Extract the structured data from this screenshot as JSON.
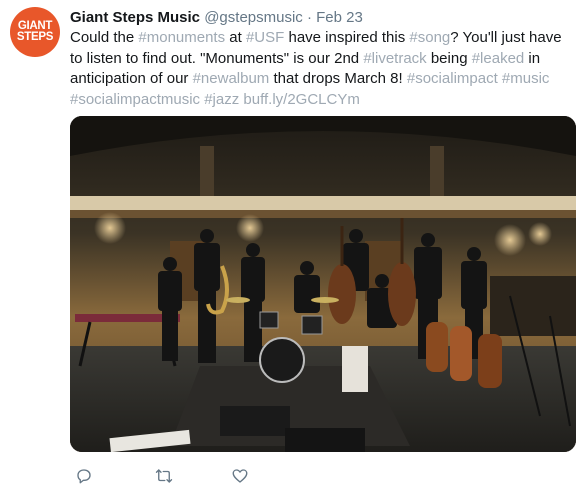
{
  "account": {
    "avatar_text": [
      "GIANT",
      "STEPS"
    ],
    "name": "Giant Steps Music",
    "handle": "@gstepsmusic",
    "separator": "·",
    "date": "Feb 23"
  },
  "tweet": {
    "t1": "Could the ",
    "h_monuments": "#monuments",
    "t2": " at ",
    "h_usf": "#USF",
    "t3": " have inspired this ",
    "h_song": "#song",
    "t4": "? You'll just have to listen to find out. \"Monuments\" is our 2nd ",
    "h_livetrack": "#livetrack",
    "t5": " being ",
    "h_leaked": "#leaked",
    "t6": " in anticipation of our ",
    "h_newalbum": "#newalbum",
    "t7": " that drops March 8! ",
    "h_socialimpact": "#socialimpact",
    "t8": " ",
    "h_music": "#music",
    "t9": " ",
    "h_socialimpactmusic": "#socialimpactmusic",
    "t10": " ",
    "h_jazz": "#jazz",
    "t11": " ",
    "link": "buff.ly/2GCLCYm"
  },
  "actions": {
    "reply_icon": "reply-icon",
    "retweet_icon": "retweet-icon",
    "like_icon": "heart-icon"
  },
  "colors": {
    "hashtag": "#9fa9b3",
    "avatar_bg": "#e8572a",
    "muted": "#657786"
  }
}
